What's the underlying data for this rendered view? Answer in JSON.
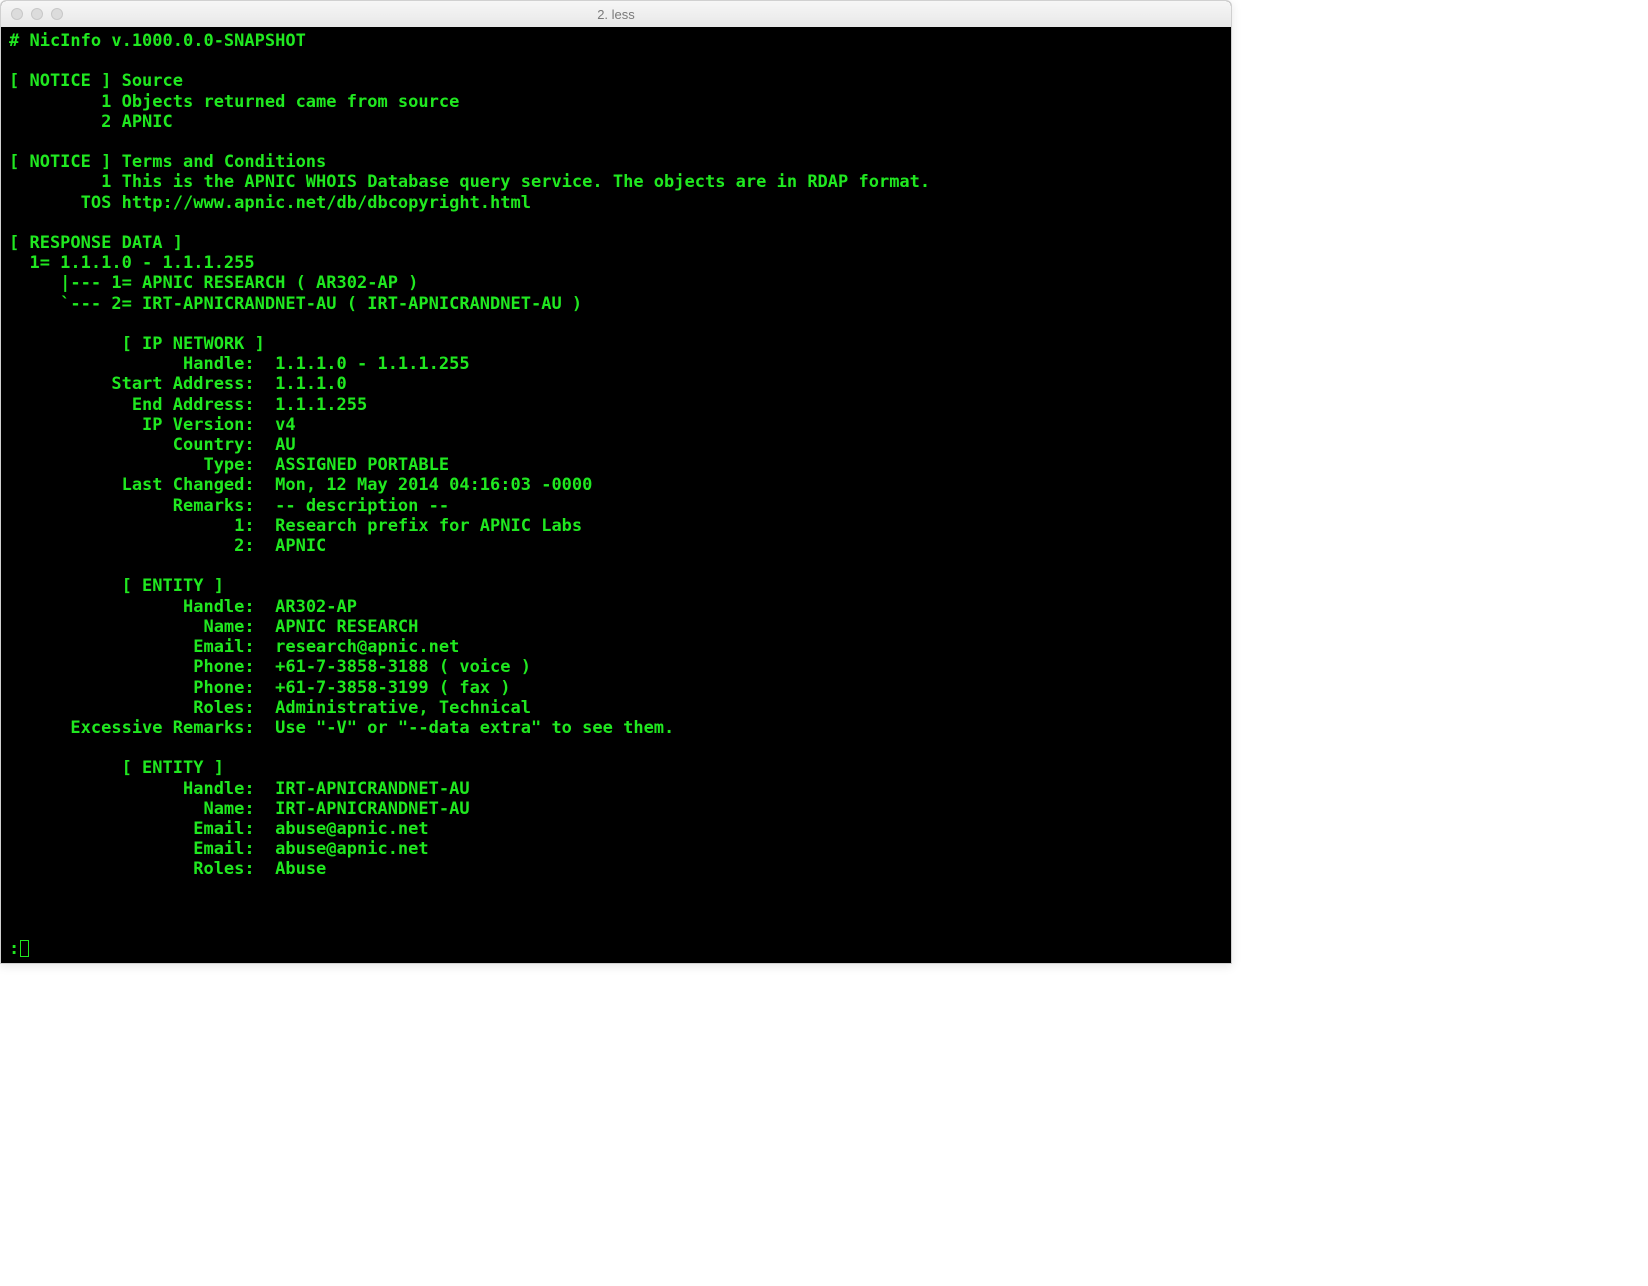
{
  "window": {
    "title": "2. less"
  },
  "header": "# NicInfo v.1000.0.0-SNAPSHOT",
  "notices": [
    {
      "header": "[ NOTICE ] Source",
      "lines": [
        "         1 Objects returned came from source",
        "         2 APNIC"
      ]
    },
    {
      "header": "[ NOTICE ] Terms and Conditions",
      "lines": [
        "         1 This is the APNIC WHOIS Database query service. The objects are in RDAP format.",
        "       TOS http://www.apnic.net/db/dbcopyright.html"
      ]
    }
  ],
  "response": {
    "header": "[ RESPONSE DATA ]",
    "tree": [
      "  1= 1.1.1.0 - 1.1.1.255",
      "     |--- 1= APNIC RESEARCH ( AR302-AP )",
      "     `--- 2= IRT-APNICRANDNET-AU ( IRT-APNICRANDNET-AU )"
    ],
    "ipnetwork": {
      "header": "           [ IP NETWORK ]",
      "rows": [
        {
          "label": "                 Handle:  ",
          "value": "1.1.1.0 - 1.1.1.255"
        },
        {
          "label": "          Start Address:  ",
          "value": "1.1.1.0"
        },
        {
          "label": "            End Address:  ",
          "value": "1.1.1.255"
        },
        {
          "label": "             IP Version:  ",
          "value": "v4"
        },
        {
          "label": "                Country:  ",
          "value": "AU"
        },
        {
          "label": "                   Type:  ",
          "value": "ASSIGNED PORTABLE"
        },
        {
          "label": "           Last Changed:  ",
          "value": "Mon, 12 May 2014 04:16:03 -0000"
        },
        {
          "label": "                Remarks:  ",
          "value": "-- description --"
        },
        {
          "label": "                      1:  ",
          "value": "Research prefix for APNIC Labs"
        },
        {
          "label": "                      2:  ",
          "value": "APNIC"
        }
      ]
    },
    "entity1": {
      "header": "           [ ENTITY ]",
      "rows": [
        {
          "label": "                 Handle:  ",
          "value": "AR302-AP"
        },
        {
          "label": "                   Name:  ",
          "value": "APNIC RESEARCH"
        },
        {
          "label": "                  Email:  ",
          "value": "research@apnic.net"
        },
        {
          "label": "                  Phone:  ",
          "value": "+61-7-3858-3188 ( voice )"
        },
        {
          "label": "                  Phone:  ",
          "value": "+61-7-3858-3199 ( fax )"
        },
        {
          "label": "                  Roles:  ",
          "value": "Administrative, Technical"
        },
        {
          "label": "      Excessive Remarks:  ",
          "value": "Use \"-V\" or \"--data extra\" to see them."
        }
      ]
    },
    "entity2": {
      "header": "           [ ENTITY ]",
      "rows": [
        {
          "label": "                 Handle:  ",
          "value": "IRT-APNICRANDNET-AU"
        },
        {
          "label": "                   Name:  ",
          "value": "IRT-APNICRANDNET-AU"
        },
        {
          "label": "                  Email:  ",
          "value": "abuse@apnic.net"
        },
        {
          "label": "                  Email:  ",
          "value": "abuse@apnic.net"
        },
        {
          "label": "                  Roles:  ",
          "value": "Abuse"
        }
      ]
    }
  },
  "prompt": ":"
}
